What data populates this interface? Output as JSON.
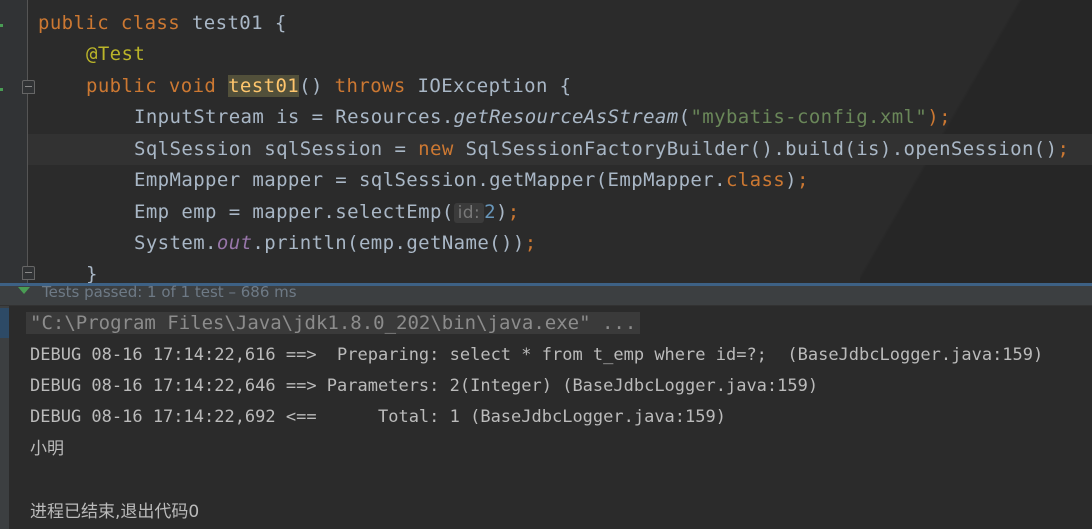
{
  "editor": {
    "lines": [
      {
        "kw1": "public",
        "kw2": "class",
        "name": "test01",
        "brace": "{"
      },
      {
        "annotation": "@Test"
      },
      {
        "kw1": "public",
        "kw2": "void",
        "method": "test01",
        "rest": "() ",
        "throws": "throws",
        "exc": " IOException {"
      },
      {
        "a": "InputStream is = Resources.",
        "b": "getResourceAsStream",
        "c": "(",
        "str": "\"mybatis-config.xml\"",
        "semi": ");"
      },
      {
        "a": "SqlSession sqlSession = ",
        "kw": "new",
        "b": " SqlSessionFactoryBuilder().build(is).openSession()",
        "semi": ";"
      },
      {
        "a": "EmpMapper mapper = sqlSession.getMapper(EmpMapper.",
        "kw": "class",
        "b": ")",
        "semi": ";"
      },
      {
        "a": "Emp emp = mapper.selectEmp(",
        "hint": "id:",
        "num": "2",
        "b": ")",
        "semi": ";"
      },
      {
        "a": "System.",
        "fld": "out",
        "b": ".println(emp.getName())",
        "semi": ";"
      },
      {
        "brace": "}"
      }
    ]
  },
  "status": {
    "text": "Tests passed: 1 of 1 test – 686 ms"
  },
  "console": {
    "command": "\"C:\\Program Files\\Java\\jdk1.8.0_202\\bin\\java.exe\" ...",
    "lines": [
      "DEBUG 08-16 17:14:22,616 ==>  Preparing: select * from t_emp where id=?;  (BaseJdbcLogger.java:159)",
      "DEBUG 08-16 17:14:22,646 ==> Parameters: 2(Integer) (BaseJdbcLogger.java:159)",
      "DEBUG 08-16 17:14:22,692 <==      Total: 1 (BaseJdbcLogger.java:159)"
    ],
    "output": "小明",
    "exit": "进程已结束,退出代码0"
  }
}
